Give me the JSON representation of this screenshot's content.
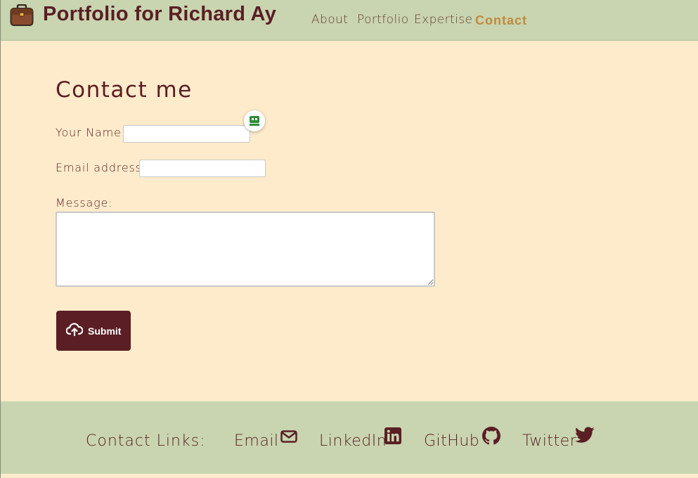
{
  "header": {
    "title": "Portfolio for Richard Ay",
    "brand_icon": "briefcase-icon",
    "nav": [
      {
        "label": "About"
      },
      {
        "label": "Portfolio"
      },
      {
        "label": "Expertise"
      },
      {
        "label": "Contact",
        "active": true
      }
    ]
  },
  "contact": {
    "title": "Contact me",
    "name_label": "Your Name:",
    "name_value": "",
    "email_label": "Email address:",
    "email_value": "",
    "message_label": "Message:",
    "message_value": "",
    "extension_icon": "password-manager-icon",
    "submit_label": "Submit",
    "submit_icon": "cloud-upload-icon"
  },
  "footer": {
    "heading": "Contact Links:",
    "links": [
      {
        "label": "Email",
        "icon": "envelope-icon"
      },
      {
        "label": "LinkedIn",
        "icon": "linkedin-icon"
      },
      {
        "label": "GitHub",
        "icon": "github-icon"
      },
      {
        "label": "Twitter",
        "icon": "twitter-icon"
      }
    ]
  },
  "colors": {
    "navbar_bg": "#C8D5B0",
    "page_bg": "#FDEBCB",
    "text": "#5a1e24",
    "active_nav": "#C08A3E",
    "button_bg": "#5a1e24"
  }
}
